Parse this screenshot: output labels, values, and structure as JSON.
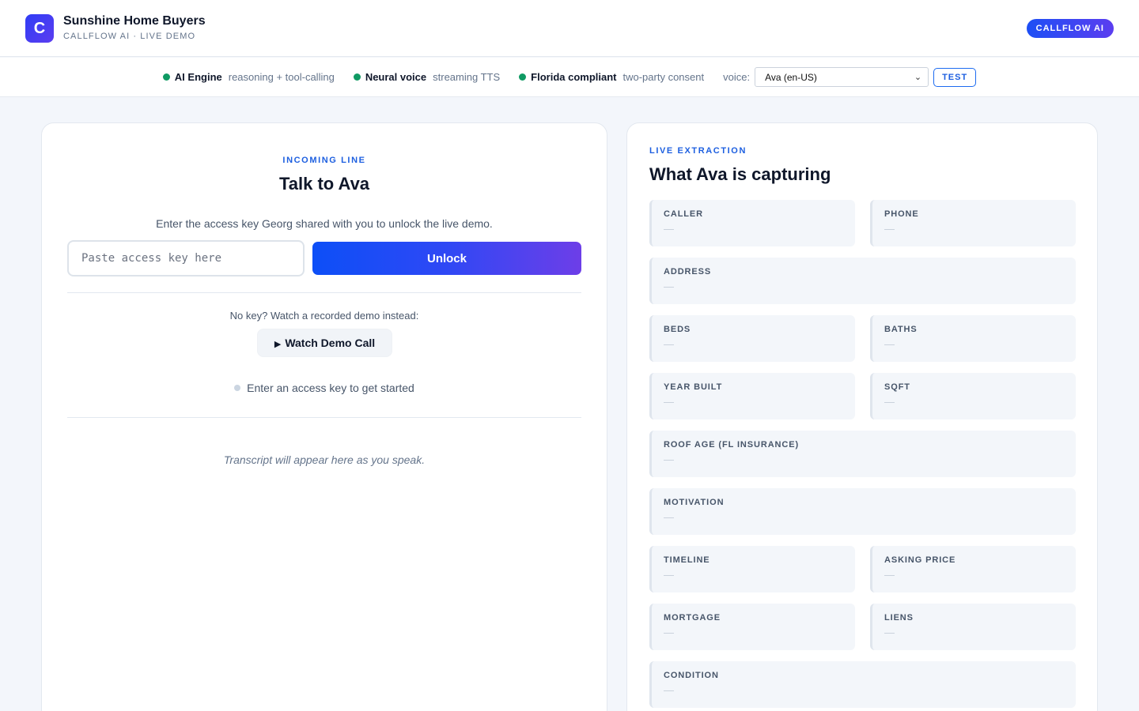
{
  "header": {
    "logo_letter": "C",
    "title": "Sunshine Home Buyers",
    "subtitle": "CALLFLOW AI · LIVE DEMO",
    "badge": "CALLFLOW AI"
  },
  "status": {
    "items": [
      {
        "name": "AI Engine",
        "desc": "reasoning + tool-calling",
        "color": "#0f9a63"
      },
      {
        "name": "Neural voice",
        "desc": "streaming TTS",
        "color": "#0f9a63"
      },
      {
        "name": "Florida compliant",
        "desc": "two-party consent",
        "color": "#0f9a63"
      }
    ],
    "voice_label": "voice:",
    "voice_selected": "Ava (en-US)",
    "test_label": "TEST"
  },
  "left": {
    "kicker": "INCOMING LINE",
    "title": "Talk to Ava",
    "description": "Enter the access key Georg shared with you to unlock the live demo.",
    "key_placeholder": "Paste access key here",
    "key_value": "",
    "unlock_label": "Unlock",
    "no_key_text": "No key? Watch a recorded demo instead:",
    "demo_button_label": "Watch Demo Call",
    "demo_button_icon": "play-icon",
    "hint_text": "Enter an access key to get started",
    "transcript_placeholder": "Transcript will appear here as you speak."
  },
  "right": {
    "kicker": "LIVE EXTRACTION",
    "title": "What Ava is capturing",
    "fields": [
      {
        "label": "CALLER",
        "value": "—"
      },
      {
        "label": "PHONE",
        "value": "—"
      },
      {
        "label": "ADDRESS",
        "value": "—"
      },
      {
        "label": "BEDS",
        "value": "—"
      },
      {
        "label": "BATHS",
        "value": "—"
      },
      {
        "label": "YEAR BUILT",
        "value": "—"
      },
      {
        "label": "SQFT",
        "value": "—"
      },
      {
        "label": "ROOF AGE (FL INSURANCE)",
        "value": "—"
      },
      {
        "label": "MOTIVATION",
        "value": "—"
      },
      {
        "label": "TIMELINE",
        "value": "—"
      },
      {
        "label": "ASKING PRICE",
        "value": "—"
      },
      {
        "label": "MORTGAGE",
        "value": "—"
      },
      {
        "label": "LIENS",
        "value": "—"
      },
      {
        "label": "CONDITION",
        "value": "—"
      }
    ]
  },
  "colors": {
    "accent": "#1d5fe0",
    "status_ok": "#0f9a63",
    "gradient_start": "#0d4ff7",
    "gradient_end": "#6d3ee8"
  }
}
